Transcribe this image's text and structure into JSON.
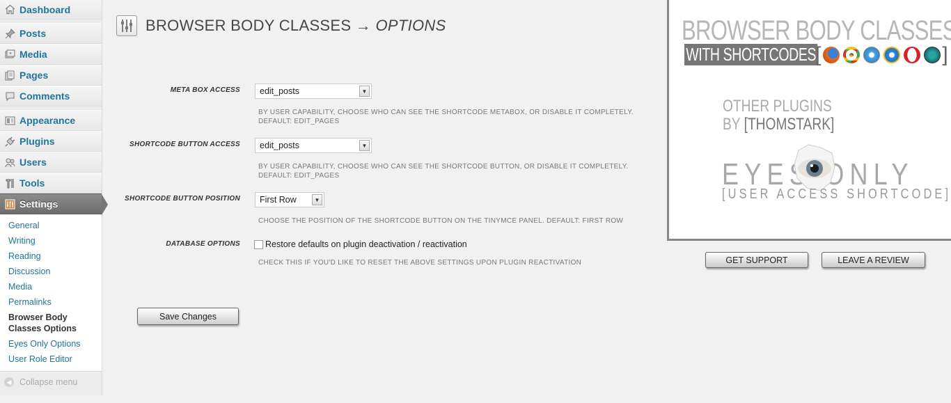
{
  "sidebar": {
    "items": [
      {
        "label": "Dashboard",
        "icon": "home-icon"
      },
      {
        "label": "Posts",
        "icon": "pushpin-icon"
      },
      {
        "label": "Media",
        "icon": "media-icon"
      },
      {
        "label": "Pages",
        "icon": "pages-icon"
      },
      {
        "label": "Comments",
        "icon": "comment-icon"
      },
      {
        "label": "Appearance",
        "icon": "appearance-icon"
      },
      {
        "label": "Plugins",
        "icon": "plug-icon"
      },
      {
        "label": "Users",
        "icon": "users-icon"
      },
      {
        "label": "Tools",
        "icon": "tools-icon"
      },
      {
        "label": "Settings",
        "icon": "settings-icon"
      }
    ],
    "submenu": [
      "General",
      "Writing",
      "Reading",
      "Discussion",
      "Media",
      "Permalinks",
      "Browser Body Classes Options",
      "Eyes Only Options",
      "User Role Editor"
    ],
    "collapse_label": "Collapse menu"
  },
  "page": {
    "title_main": "BROWSER BODY CLASSES →",
    "title_em": "OPTIONS"
  },
  "fields": {
    "meta_box": {
      "label": "META BOX ACCESS",
      "value": "edit_posts",
      "desc1": "BY USER CAPABILITY, CHOOSE WHO CAN SEE THE SHORTCODE METABOX, OR DISABLE IT COMPLETELY.",
      "desc2": "DEFAULT: EDIT_PAGES"
    },
    "shortcode_access": {
      "label": "SHORTCODE BUTTON ACCESS",
      "value": "edit_posts",
      "desc1": "BY USER CAPABILITY, CHOOSE WHO CAN SEE THE SHORTCODE BUTTON, OR DISABLE IT COMPLETELY.",
      "desc2": "DEFAULT: EDIT_PAGES"
    },
    "shortcode_position": {
      "label": "SHORTCODE BUTTON POSITION",
      "value": "First Row",
      "desc1": "CHOOSE THE POSITION OF THE SHORTCODE BUTTON ON THE TINYMCE PANEL. DEFAULT: FIRST ROW"
    },
    "database": {
      "label": "DATABASE OPTIONS",
      "checkbox_label": "Restore defaults on plugin deactivation / reactivation",
      "checked": false,
      "desc1": "CHECK THIS IF YOU'D LIKE TO RESET THE ABOVE SETTINGS UPON PLUGIN REACTIVATION"
    }
  },
  "save_label": "Save Changes",
  "promo": {
    "title": "BROWSER BODY CLASSES",
    "subtitle": "WITH SHORTCODES",
    "browser_icons": [
      "firefox-icon",
      "chrome-icon",
      "safari-icon",
      "ie-icon",
      "opera-icon",
      "netscape-icon"
    ],
    "other_line1": "OTHER PLUGINS",
    "other_line2_prefix": "BY",
    "other_line2_author": "[THOMSTARK]",
    "eyes_title": "EYES  ONLY",
    "eyes_sub": "[USER ACCESS SHORTCODE]",
    "support_label": "GET SUPPORT",
    "review_label": "LEAVE A REVIEW"
  }
}
